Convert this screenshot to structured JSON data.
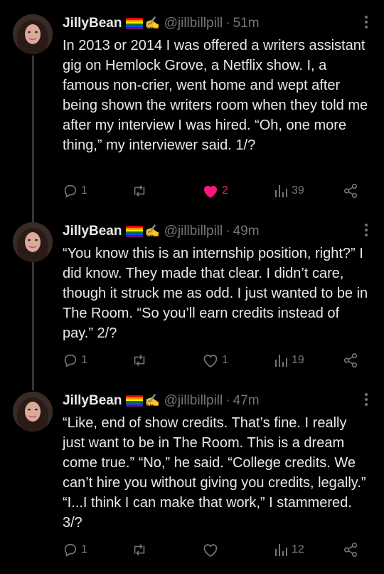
{
  "tweets": [
    {
      "author": "JillyBean",
      "handle": "@jillbillpill",
      "separator": "·",
      "time": "51m",
      "text": "In 2013 or 2014 I was offered a writers assistant gig on Hemlock Grove, a Netflix show. I, a famous non-crier, went home and wept after being shown the writers room when they told me after my interview I was hired. “Oh, one more thing,” my interviewer said. 1/?",
      "replies": "1",
      "retweets": "",
      "likes": "2",
      "liked": true,
      "views": "39"
    },
    {
      "author": "JillyBean",
      "handle": "@jillbillpill",
      "separator": "·",
      "time": "49m",
      "text": "“You know this is an internship position, right?” I did know. They made that clear. I didn’t care, though it struck me as odd. I just wanted to be in The Room. “So you’ll earn credits instead of pay.” 2/?",
      "replies": "1",
      "retweets": "",
      "likes": "1",
      "liked": false,
      "views": "19"
    },
    {
      "author": "JillyBean",
      "handle": "@jillbillpill",
      "separator": "·",
      "time": "47m",
      "text": "“Like, end of show credits. That’s fine. I really just want to be in The Room. This is a dream come true.” “No,” he said. “College credits. We can’t hire you without giving you credits, legally.” “I...I think I can make that work,” I stammered. 3/?",
      "replies": "1",
      "retweets": "",
      "likes": "",
      "liked": false,
      "views": "12"
    }
  ],
  "colors": {
    "background": "#000000",
    "text": "#e7e9ea",
    "muted": "#71767b",
    "like": "#f91880",
    "thread_line": "#333639"
  },
  "icons": [
    "avatar",
    "pride-flag-icon",
    "writing-hand-icon",
    "more-icon",
    "reply-icon",
    "retweet-icon",
    "like-icon",
    "views-icon",
    "share-icon"
  ]
}
